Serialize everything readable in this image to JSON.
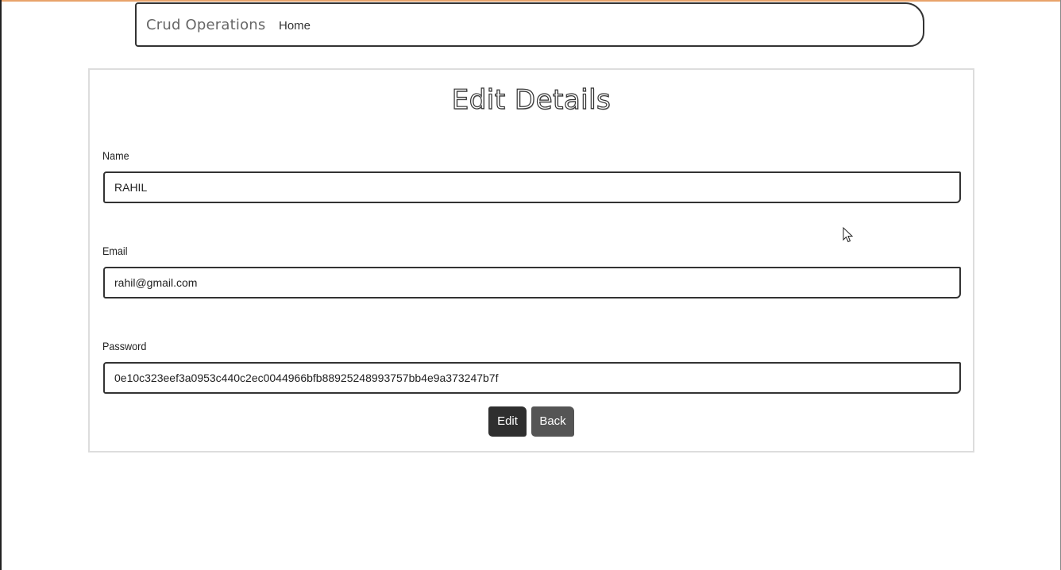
{
  "navbar": {
    "brand": "Crud Operations",
    "links": [
      {
        "label": "Home"
      }
    ]
  },
  "form": {
    "title": "Edit Details",
    "fields": [
      {
        "label": "Name",
        "value": "RAHIL"
      },
      {
        "label": "Email",
        "value": "rahil@gmail.com"
      },
      {
        "label": "Password",
        "value": "0e10c323eef3a0953c440c2ec0044966bfb88925248993757bb4e9a373247b7f"
      }
    ],
    "buttons": {
      "edit": "Edit",
      "back": "Back"
    }
  },
  "colors": {
    "top_accent": "#e8a36a",
    "edit_button": "#2f2f2f",
    "back_button": "#555555"
  },
  "icons": {
    "cursor": "mouse-pointer-icon"
  }
}
